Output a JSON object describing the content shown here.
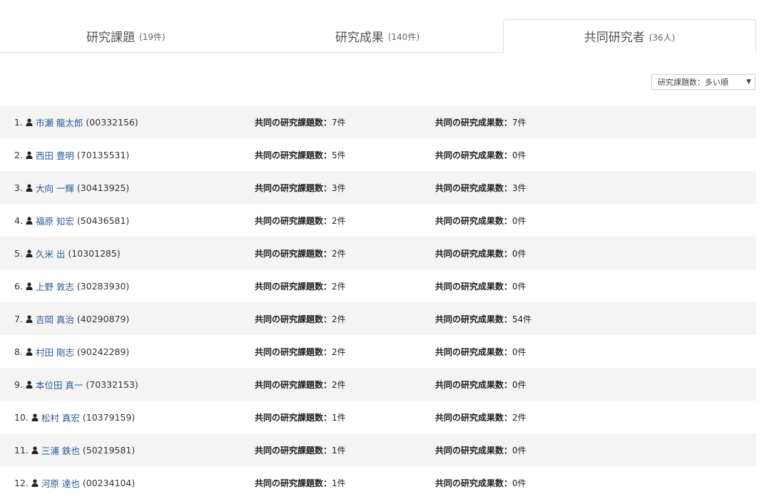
{
  "tabs": [
    {
      "label": "研究課題",
      "count": "(19件)",
      "active": false
    },
    {
      "label": "研究成果",
      "count": "(140件)",
      "active": false
    },
    {
      "label": "共同研究者",
      "count": "(36人)",
      "active": true
    }
  ],
  "sort": {
    "selected": "研究課題数：多い順"
  },
  "columns": {
    "projects_label": "共同の研究課題数：",
    "results_label": "共同の研究成果数："
  },
  "researchers": [
    {
      "index": "1.",
      "name": "市瀬 龍太郎",
      "id": "(00332156)",
      "projects": "7件",
      "results": "7件"
    },
    {
      "index": "2.",
      "name": "西田 豊明",
      "id": "(70135531)",
      "projects": "5件",
      "results": "0件"
    },
    {
      "index": "3.",
      "name": "大向 一輝",
      "id": "(30413925)",
      "projects": "3件",
      "results": "3件"
    },
    {
      "index": "4.",
      "name": "福原 知宏",
      "id": "(50436581)",
      "projects": "2件",
      "results": "0件"
    },
    {
      "index": "5.",
      "name": "久米 出",
      "id": "(10301285)",
      "projects": "2件",
      "results": "0件"
    },
    {
      "index": "6.",
      "name": "上野 敦志",
      "id": "(30283930)",
      "projects": "2件",
      "results": "0件"
    },
    {
      "index": "7.",
      "name": "吉岡 真治",
      "id": "(40290879)",
      "projects": "2件",
      "results": "54件"
    },
    {
      "index": "8.",
      "name": "村田 剛志",
      "id": "(90242289)",
      "projects": "2件",
      "results": "0件"
    },
    {
      "index": "9.",
      "name": "本位田 真一",
      "id": "(70332153)",
      "projects": "2件",
      "results": "0件"
    },
    {
      "index": "10.",
      "name": "松村 真宏",
      "id": "(10379159)",
      "projects": "1件",
      "results": "2件"
    },
    {
      "index": "11.",
      "name": "三浦 鉄也",
      "id": "(50219581)",
      "projects": "1件",
      "results": "0件"
    },
    {
      "index": "12.",
      "name": "河原 達也",
      "id": "(00234104)",
      "projects": "1件",
      "results": "0件"
    }
  ]
}
